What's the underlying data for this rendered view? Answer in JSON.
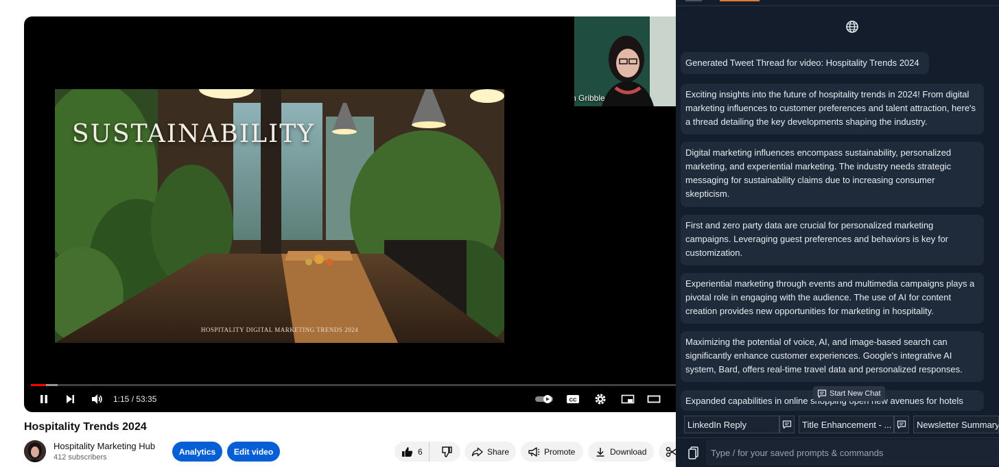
{
  "player": {
    "slide_title": "SUSTAINABILITY",
    "slide_footer": "HOSPITALITY DIGITAL MARKETING TRENDS 2024",
    "webcam_name": "Dawn Gribble",
    "time": "1:15 / 53:35",
    "progress": 0.023
  },
  "video": {
    "title": "Hospitality Trends 2024",
    "channel": "Hospitality Marketing Hub",
    "subscribers": "412 subscribers",
    "analytics_label": "Analytics",
    "edit_label": "Edit video",
    "likes": "6",
    "share_label": "Share",
    "promote_label": "Promote",
    "download_label": "Download"
  },
  "panel": {
    "header": "Generated Tweet Thread for video: Hospitality Trends 2024",
    "messages": [
      "Exciting insights into the future of hospitality trends in 2024! From digital marketing influences to customer preferences and talent attraction, here's a thread detailing the key developments shaping the industry.",
      "Digital marketing influences encompass sustainability, personalized marketing, and experiential marketing. The industry needs strategic messaging for sustainability claims due to increasing consumer skepticism.",
      "First and zero party data are crucial for personalized marketing campaigns. Leveraging guest preferences and behaviors is key for customization.",
      "Experiential marketing through events and multimedia campaigns plays a pivotal role in engaging with the audience. The use of AI for content creation provides new opportunities for marketing in hospitality.",
      "Maximizing the potential of voice, AI, and image-based search can significantly enhance customer experiences. Google's integrative AI system, Bard, offers real-time travel data and personalized responses.",
      "Expanded capabilities in online shopping open new avenues for hotels"
    ],
    "new_chat_label": "Start New Chat",
    "chips": [
      "LinkedIn Reply",
      "Title Enhancement - ...",
      "Newsletter Summary"
    ],
    "prompt_placeholder": "Type / for your saved prompts & commands"
  },
  "colors": {
    "accent_blue": "#065fd4",
    "panel_bg": "#141d2b",
    "bubble_bg": "#1f2a3a",
    "progress_red": "#ff0000"
  }
}
